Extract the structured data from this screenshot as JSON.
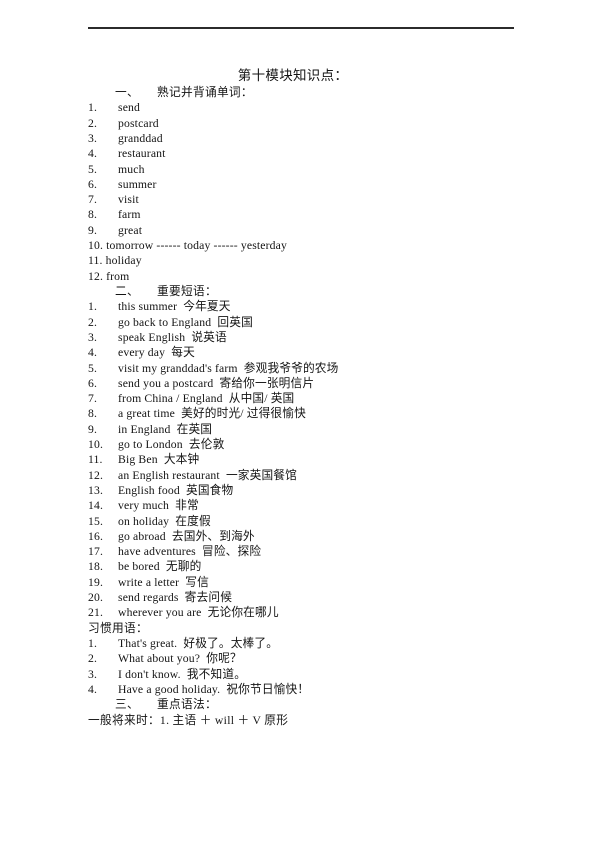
{
  "document": {
    "title": "第十模块知识点："
  },
  "sections": {
    "words": {
      "number": "一、",
      "heading": "熟记并背诵单词：",
      "items": [
        {
          "index": "1.",
          "text": "send"
        },
        {
          "index": "2.",
          "text": "postcard"
        },
        {
          "index": "3.",
          "text": "granddad"
        },
        {
          "index": "4.",
          "text": "restaurant"
        },
        {
          "index": "5.",
          "text": "much"
        },
        {
          "index": "6.",
          "text": "summer"
        },
        {
          "index": "7.",
          "text": "visit"
        },
        {
          "index": "8.",
          "text": "farm"
        },
        {
          "index": "9.",
          "text": "great"
        },
        {
          "index": "10.",
          "text": "tomorrow ------ today ------ yesterday"
        },
        {
          "index": "11.",
          "text": "holiday"
        },
        {
          "index": "12.",
          "text": "from"
        }
      ]
    },
    "phrases": {
      "number": "二、",
      "heading": "重要短语：",
      "items": [
        {
          "index": "1.",
          "text": "this summer  今年夏天"
        },
        {
          "index": "2.",
          "text": "go back to England  回英国"
        },
        {
          "index": "3.",
          "text": "speak English  说英语"
        },
        {
          "index": "4.",
          "text": "every day  每天"
        },
        {
          "index": "5.",
          "text": "visit my granddad's farm  参观我爷爷的农场"
        },
        {
          "index": "6.",
          "text": "send you a postcard  寄给你一张明信片"
        },
        {
          "index": "7.",
          "text": "from China / England  从中国/ 英国"
        },
        {
          "index": "8.",
          "text": "a great time  美好的时光/ 过得很愉快"
        },
        {
          "index": "9.",
          "text": "in England  在英国"
        },
        {
          "index": "10.",
          "text": "go to London  去伦敦"
        },
        {
          "index": "11.",
          "text": "Big Ben  大本钟"
        },
        {
          "index": "12.",
          "text": "an English restaurant  一家英国餐馆"
        },
        {
          "index": "13.",
          "text": "English food  英国食物"
        },
        {
          "index": "14.",
          "text": "very much  非常"
        },
        {
          "index": "15.",
          "text": "on holiday  在度假"
        },
        {
          "index": "16.",
          "text": "go abroad  去国外、到海外"
        },
        {
          "index": "17.",
          "text": "have adventures  冒险、探险"
        },
        {
          "index": "18.",
          "text": "be bored  无聊的"
        },
        {
          "index": "19.",
          "text": "write a letter  写信"
        },
        {
          "index": "20.",
          "text": "send regards  寄去问候"
        },
        {
          "index": "21.",
          "text": "wherever you are  无论你在哪儿"
        }
      ]
    },
    "idioms": {
      "heading": "习惯用语：",
      "items": [
        {
          "index": "1.",
          "text": "That's great.  好极了。太棒了。"
        },
        {
          "index": "2.",
          "text": "What about you?  你呢？"
        },
        {
          "index": "3.",
          "text": "I don't know.  我不知道。"
        },
        {
          "index": "4.",
          "text": "Have a good holiday.  祝你节日愉快！"
        }
      ]
    },
    "grammar": {
      "number": "三、",
      "heading": "重点语法：",
      "rule": "一般将来时：1. 主语 ＋ will ＋ V 原形"
    }
  }
}
